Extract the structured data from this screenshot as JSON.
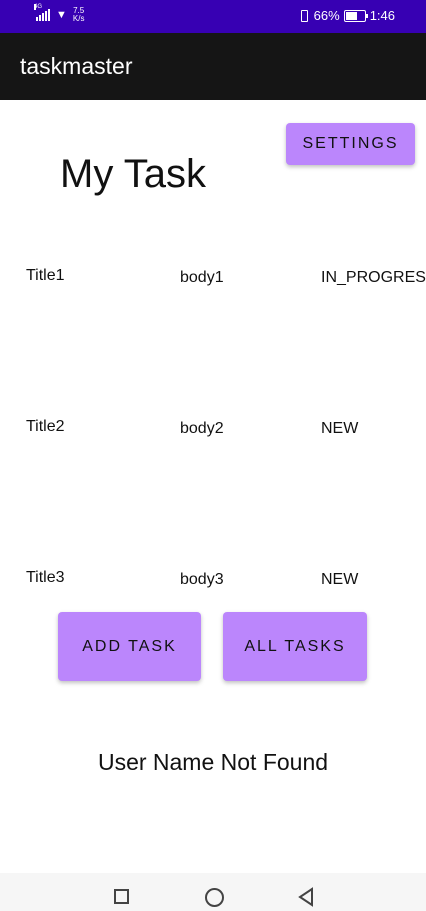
{
  "status_bar": {
    "network": "4G",
    "speed_value": "7.5",
    "speed_unit": "K/s",
    "battery_percent": "66%",
    "time": "1:46",
    "battery_level": 0.66
  },
  "app_bar": {
    "title": "taskmaster"
  },
  "settings_button": "SETTINGS",
  "page_title": "My Task",
  "tasks": [
    {
      "title": "Title1",
      "body": "body1",
      "state": "IN_PROGRESS"
    },
    {
      "title": "Title2",
      "body": "body2",
      "state": "NEW"
    },
    {
      "title": "Title3",
      "body": "body3",
      "state": "NEW"
    }
  ],
  "add_task_button": "ADD TASK",
  "all_tasks_button": "ALL TASKS",
  "username_text": "User Name Not Found",
  "colors": {
    "status_bar": "#3700b3",
    "app_bar": "#151515",
    "button": "#bb86fc"
  }
}
